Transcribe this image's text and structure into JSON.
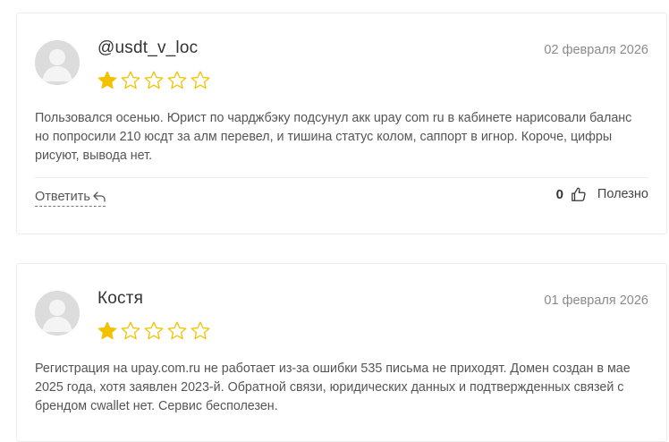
{
  "reviews": [
    {
      "author": "@usdt_v_loc",
      "date": "02 февраля 2026",
      "rating": 1,
      "rating_max": 5,
      "text": "Пользовался осенью. Юрист по чарджбэку подсунул акк upay com ru в кабинете нарисовали баланс но попросили 210 юсдт за алм перевел, и тишина статус колом, саппорт в игнор. Короче, цифры рисуют, вывода нет.",
      "reply_label": "Ответить",
      "like_count": "0",
      "useful_label": "Полезно"
    },
    {
      "author": "Костя",
      "date": "01 февраля 2026",
      "rating": 1,
      "rating_max": 5,
      "text": "Регистрация на upay.com.ru не работает из-за ошибки 535 письма не приходят. Домен создан в мае 2025 года, хотя заявлен 2023-й. Обратной связи, юридических данных и подтвержденных связей с брендом cwallet нет. Сервис бесполезен."
    }
  ],
  "colors": {
    "star_filled": "#f2c200",
    "star_outline": "#f2c200",
    "avatar_bg": "#dcdcdc",
    "card_border": "#ececec"
  }
}
